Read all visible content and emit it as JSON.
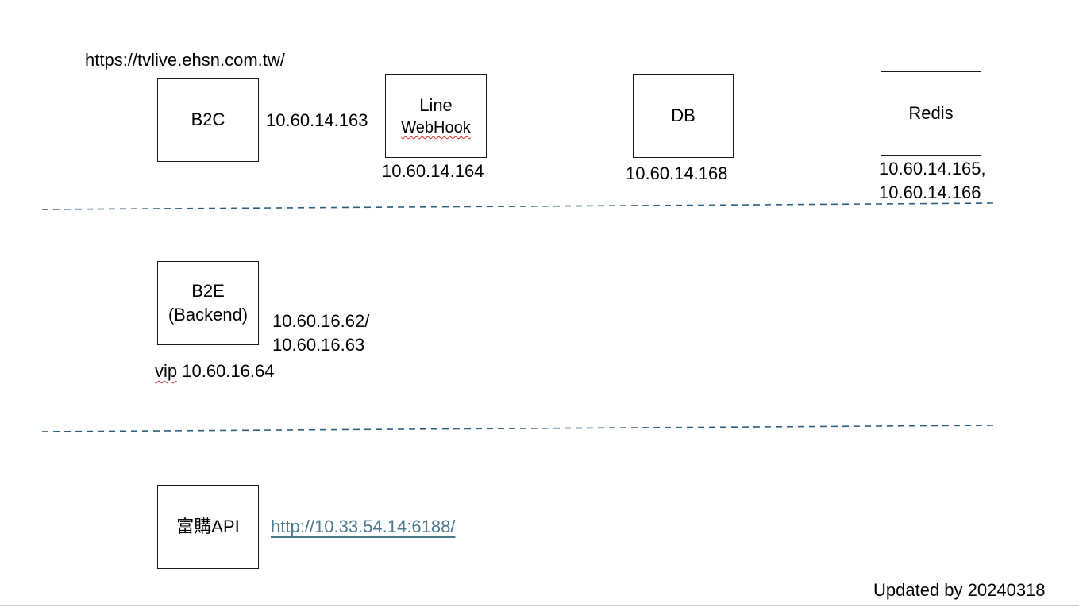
{
  "header": {
    "url": "https://tvlive.ehsn.com.tw/"
  },
  "tier1": {
    "b2c": {
      "label": "B2C",
      "ip": "10.60.14.163"
    },
    "linewebhook": {
      "line1": "Line",
      "line2": "WebHook",
      "ip": "10.60.14.164"
    },
    "db": {
      "label": "DB",
      "ip": "10.60.14.168"
    },
    "redis": {
      "label": "Redis",
      "ip_line1": "10.60.14.165,",
      "ip_line2": "10.60.14.166"
    }
  },
  "tier2": {
    "b2e": {
      "line1": "B2E",
      "line2": "(Backend)",
      "ip_line1": "10.60.16.62/",
      "ip_line2": "10.60.16.63"
    },
    "vip": {
      "prefix": "vip",
      "address": " 10.60.16.64"
    }
  },
  "tier3": {
    "api": {
      "label": "富購API",
      "url": "http://10.33.54.14:6188/"
    }
  },
  "footer": {
    "updated": "Updated by 20240318"
  },
  "colors": {
    "separator": "#2e5f7a",
    "link": "#4a7a8c",
    "box_border": "#1a1a1a",
    "spellcheck": "#d03030"
  }
}
